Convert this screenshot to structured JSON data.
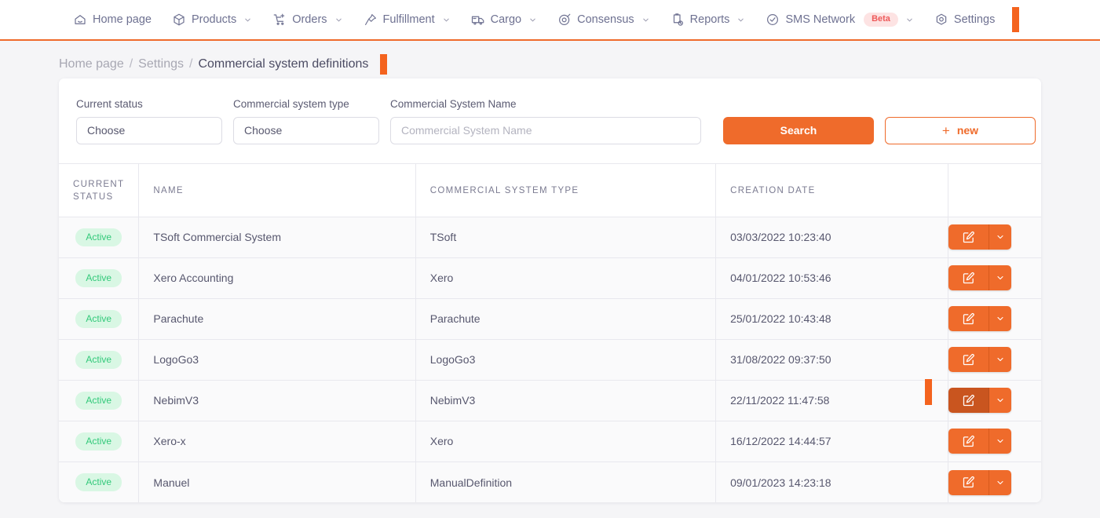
{
  "nav": {
    "items": [
      {
        "label": "Home page",
        "icon": "home-icon",
        "caret": false,
        "badge": null
      },
      {
        "label": "Products",
        "icon": "box-icon",
        "caret": true,
        "badge": null
      },
      {
        "label": "Orders",
        "icon": "cart-plus-icon",
        "caret": true,
        "badge": null
      },
      {
        "label": "Fulfillment",
        "icon": "pin-icon",
        "caret": true,
        "badge": null
      },
      {
        "label": "Cargo",
        "icon": "truck-icon",
        "caret": true,
        "badge": null
      },
      {
        "label": "Consensus",
        "icon": "target-icon",
        "caret": true,
        "badge": null
      },
      {
        "label": "Reports",
        "icon": "clipboard-icon",
        "caret": true,
        "badge": null
      },
      {
        "label": "SMS Network",
        "icon": "check-circle-icon",
        "caret": true,
        "badge": "Beta"
      },
      {
        "label": "Settings",
        "icon": "hexagon-gear-icon",
        "caret": false,
        "badge": null
      }
    ],
    "cursor_marker": true
  },
  "breadcrumb": {
    "home": "Home page",
    "separator": "/",
    "settings": "Settings",
    "current": "Commercial system definitions"
  },
  "filters": {
    "status": {
      "label": "Current status",
      "value": "Choose"
    },
    "type": {
      "label": "Commercial system type",
      "value": "Choose"
    },
    "name": {
      "label": "Commercial System Name",
      "value": "",
      "placeholder": "Commercial System Name"
    },
    "search_label": "Search",
    "new_label": "new",
    "new_plus": "+"
  },
  "table": {
    "headers": {
      "status": "CURRENT STATUS",
      "status_line1": "CURRENT",
      "status_line2": "STATUS",
      "name": "NAME",
      "type": "COMMERCIAL SYSTEM TYPE",
      "date": "CREATION DATE",
      "actions": ""
    },
    "rows": [
      {
        "status": "Active",
        "name": "TSoft Commercial System",
        "type": "TSoft",
        "date": "03/03/2022 10:23:40",
        "active_button": false
      },
      {
        "status": "Active",
        "name": "Xero Accounting",
        "type": "Xero",
        "date": "04/01/2022 10:53:46",
        "active_button": false
      },
      {
        "status": "Active",
        "name": "Parachute",
        "type": "Parachute",
        "date": "25/01/2022 10:43:48",
        "active_button": false
      },
      {
        "status": "Active",
        "name": "LogoGo3",
        "type": "LogoGo3",
        "date": "31/08/2022 09:37:50",
        "active_button": false
      },
      {
        "status": "Active",
        "name": "NebimV3",
        "type": "NebimV3",
        "date": "22/11/2022 11:47:58",
        "active_button": true
      },
      {
        "status": "Active",
        "name": "Xero-x",
        "type": "Xero",
        "date": "16/12/2022 14:44:57",
        "active_button": false
      },
      {
        "status": "Active",
        "name": "Manuel",
        "type": "ManualDefinition",
        "date": "09/01/2023 14:23:18",
        "active_button": false
      }
    ]
  },
  "colors": {
    "accent": "#ef6b2b",
    "cursor": "#f4631e",
    "active_badge_bg": "#d9f7e4",
    "active_badge_text": "#32c97a",
    "beta_bg": "#fde3e3",
    "beta_text": "#ee5a5a",
    "page_bg": "#f5f5f7",
    "text": "#57576e"
  }
}
